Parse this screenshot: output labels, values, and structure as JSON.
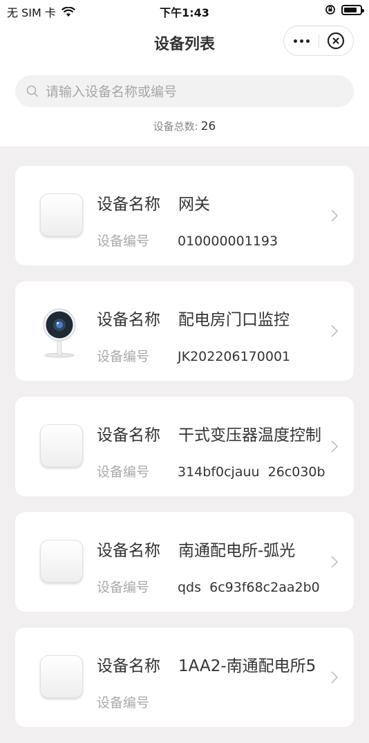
{
  "status_bar": {
    "carrier": "无 SIM 卡",
    "time": "下午1:43"
  },
  "nav": {
    "title": "设备列表"
  },
  "search": {
    "placeholder": "请输入设备名称或编号",
    "value": ""
  },
  "summary": {
    "label": "设备总数:",
    "count": "26"
  },
  "devices": [
    {
      "name_label": "设备名称",
      "name": "网关",
      "code_label": "设备编号",
      "code": "010000001193",
      "icon": "gateway-icon"
    },
    {
      "name_label": "设备名称",
      "name": "配电房门口监控",
      "code_label": "设备编号",
      "code": "JK202206170001",
      "icon": "camera-icon"
    },
    {
      "name_label": "设备名称",
      "name": "干式变压器温度控制",
      "code_label": "设备编号",
      "code": "314bf0cjauu  26c030b",
      "icon": "gateway-icon"
    },
    {
      "name_label": "设备名称",
      "name": "南通配电所-弧光",
      "code_label": "设备编号",
      "code": "qds  6c93f68c2aa2b0",
      "icon": "gateway-icon"
    },
    {
      "name_label": "设备名称",
      "name": "1AA2-南通配电所5",
      "code_label": "设备编号",
      "code": "",
      "icon": "gateway-icon"
    }
  ]
}
